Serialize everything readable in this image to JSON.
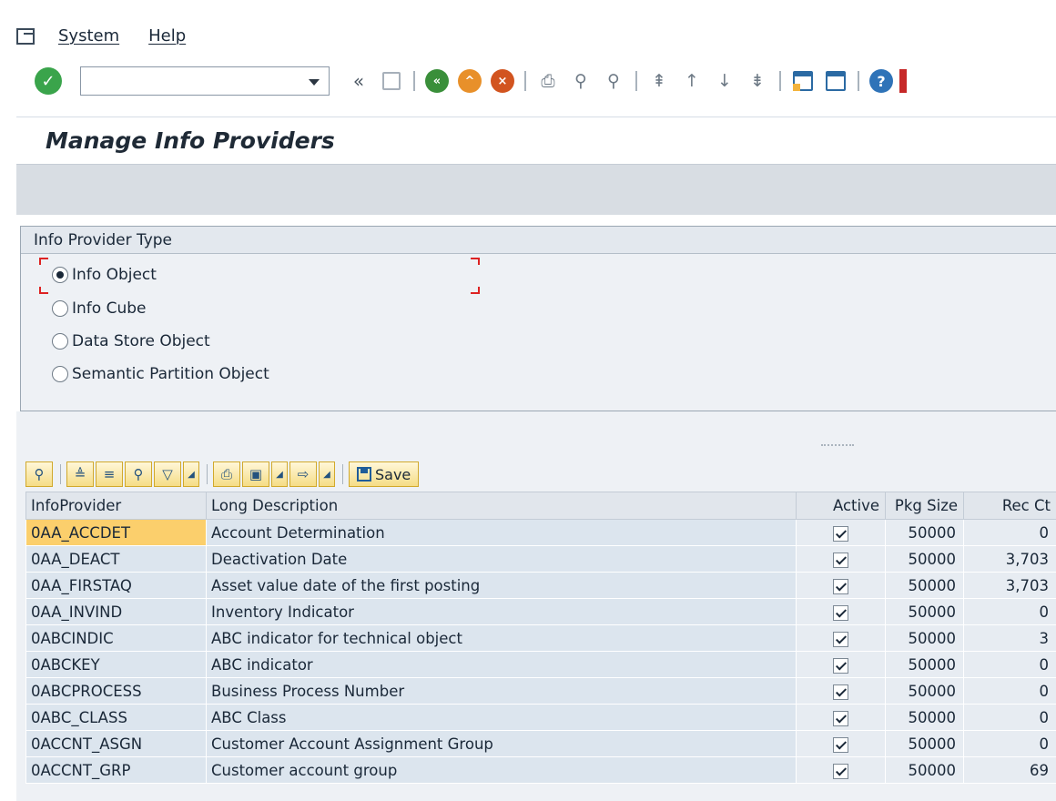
{
  "menu": {
    "items": [
      {
        "label": "System"
      },
      {
        "label": "Help"
      }
    ]
  },
  "toolbar": {
    "command_value": "",
    "icons": [
      "checkmark-icon",
      "back-icon",
      "exit-icon",
      "cancel-icon",
      "print-icon",
      "find-icon",
      "find-next-icon",
      "first-page-icon",
      "previous-page-icon",
      "next-page-icon",
      "last-page-icon",
      "create-session-icon",
      "shortcut-icon",
      "help-icon"
    ]
  },
  "title": "Manage Info Providers",
  "provider_type": {
    "legend": "Info Provider Type",
    "options": [
      {
        "label": "Info Object",
        "selected": true
      },
      {
        "label": "Info Cube",
        "selected": false
      },
      {
        "label": "Data Store Object",
        "selected": false
      },
      {
        "label": "Semantic Partition Object",
        "selected": false
      }
    ]
  },
  "alv": {
    "save_label": "Save"
  },
  "grid": {
    "columns": [
      "InfoProvider",
      "Long Description",
      "Active",
      "Pkg Size",
      "Rec Ct"
    ],
    "rows": [
      {
        "provider": "0AA_ACCDET",
        "description": "Account Determination",
        "active": true,
        "pkg_size": "50000",
        "rec_ct": "0"
      },
      {
        "provider": "0AA_DEACT",
        "description": "Deactivation Date",
        "active": true,
        "pkg_size": "50000",
        "rec_ct": "3,703"
      },
      {
        "provider": "0AA_FIRSTAQ",
        "description": "Asset value date of the first posting",
        "active": true,
        "pkg_size": "50000",
        "rec_ct": "3,703"
      },
      {
        "provider": "0AA_INVIND",
        "description": "Inventory Indicator",
        "active": true,
        "pkg_size": "50000",
        "rec_ct": "0"
      },
      {
        "provider": "0ABCINDIC",
        "description": "ABC indicator for technical object",
        "active": true,
        "pkg_size": "50000",
        "rec_ct": "3"
      },
      {
        "provider": "0ABCKEY",
        "description": "ABC indicator",
        "active": true,
        "pkg_size": "50000",
        "rec_ct": "0"
      },
      {
        "provider": "0ABCPROCESS",
        "description": "Business Process Number",
        "active": true,
        "pkg_size": "50000",
        "rec_ct": "0"
      },
      {
        "provider": "0ABC_CLASS",
        "description": "ABC Class",
        "active": true,
        "pkg_size": "50000",
        "rec_ct": "0"
      },
      {
        "provider": "0ACCNT_ASGN",
        "description": "Customer Account Assignment Group",
        "active": true,
        "pkg_size": "50000",
        "rec_ct": "0"
      },
      {
        "provider": "0ACCNT_GRP",
        "description": "Customer account group",
        "active": true,
        "pkg_size": "50000",
        "rec_ct": "69"
      }
    ]
  }
}
